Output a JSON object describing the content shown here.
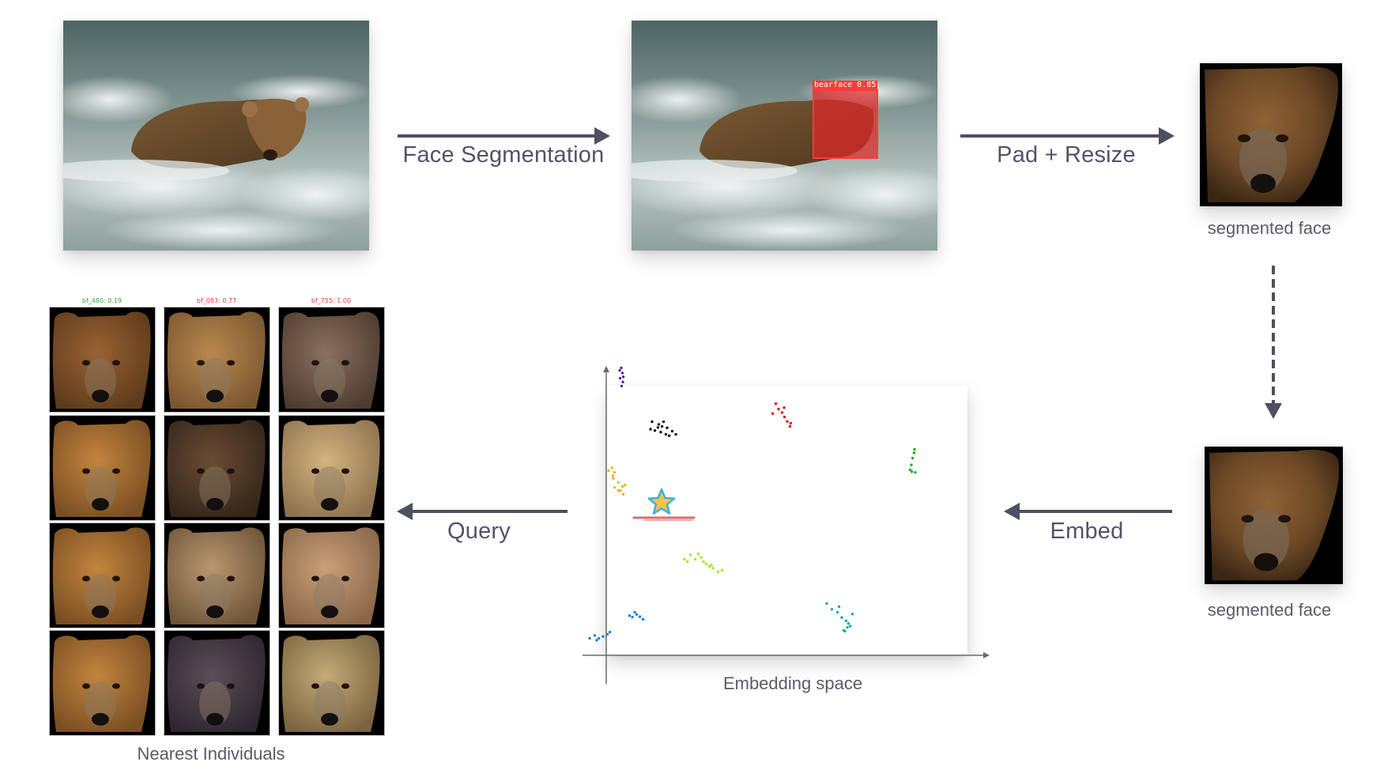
{
  "diagram": {
    "steps": {
      "face_segmentation": "Face Segmentation",
      "pad_resize": "Pad + Resize",
      "embed": "Embed",
      "query": "Query"
    },
    "captions": {
      "segmented_face_top": "segmented face",
      "segmented_face_bottom": "segmented face",
      "embedding_space": "Embedding space",
      "nearest_individuals": "Nearest Individuals"
    },
    "detection": {
      "label": "bearface 0.85",
      "class": "bearface",
      "confidence": 0.85,
      "color": "#ff3a3a"
    },
    "nearest_grid": {
      "columns": [
        {
          "label": "bf_480: 0.19",
          "color": "#3aa83a"
        },
        {
          "label": "bf_083: 0.77",
          "color": "#e03a3a"
        },
        {
          "label": "bf_755: 1.00",
          "color": "#e03a3a"
        }
      ],
      "rows": 4,
      "cells": [
        [
          "bear-face-brown",
          "bear-face-tan",
          "bear-face-grey-brown"
        ],
        [
          "bear-face-golden",
          "bear-face-dark-brown",
          "bear-face-blonde"
        ],
        [
          "bear-face-golden",
          "bear-face-light-brown",
          "bear-face-blurry-tan"
        ],
        [
          "bear-face-golden",
          "bear-face-dark-grey",
          "bear-face-blurry-blonde"
        ]
      ]
    },
    "embedding": {
      "clusters": [
        {
          "name": "purple",
          "color": "#5a1ea0"
        },
        {
          "name": "red",
          "color": "#e01010"
        },
        {
          "name": "black",
          "color": "#111111"
        },
        {
          "name": "green",
          "color": "#18b018"
        },
        {
          "name": "orange",
          "color": "#f5b01e"
        },
        {
          "name": "lime",
          "color": "#a6e81a"
        },
        {
          "name": "blue",
          "color": "#1a7fd8"
        },
        {
          "name": "teal",
          "color": "#18a89a"
        }
      ],
      "query_marker": {
        "shape": "star",
        "fill": "#f6c24a",
        "stroke": "#39b1e6"
      },
      "highlight_color": "#d9534f"
    },
    "colors": {
      "arrow": "#4f4f63",
      "text": "#535366"
    }
  }
}
